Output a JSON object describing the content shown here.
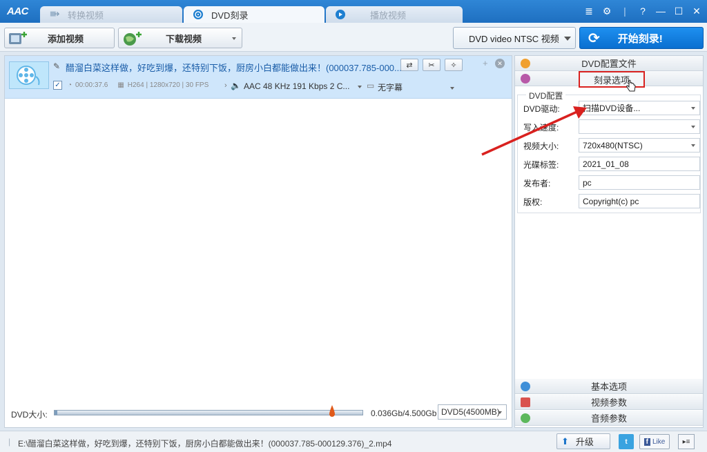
{
  "app": {
    "logo": "AAC"
  },
  "tabs": [
    {
      "label": "转换视频",
      "active": false
    },
    {
      "label": "DVD刻录",
      "active": true
    },
    {
      "label": "播放视频",
      "active": false
    }
  ],
  "window_controls": [
    "≣",
    "⚙",
    "?",
    "—",
    "☐",
    "✕"
  ],
  "toolbar": {
    "add_video": "添加视频",
    "download_video": "下载视频",
    "profile": "DVD video NTSC 视频",
    "start_burn": "开始刻录!"
  },
  "file": {
    "title": "醋溜白菜这样做，好吃到爆，还特别下饭，厨房小白都能做出来！(000037.785-000...",
    "duration": "00:00:37.6",
    "video_info": "H264 | 1280x720 | 30 FPS",
    "audio": "AAC 48 KHz 191 Kbps 2 C...",
    "subtitle": "无字幕",
    "checked": true
  },
  "size_bar": {
    "label": "DVD大小:",
    "value": "0.036Gb/4.500Gb",
    "disc_type": "DVD5(4500MB)",
    "progress": 0.008
  },
  "right_panel": {
    "profile_header": "DVD配置文件",
    "burn_options_header": "刻录选项",
    "group_title": "DVD配置",
    "fields": [
      {
        "label": "DVD驱动:",
        "value": "扫描DVD设备...",
        "dropdown": true
      },
      {
        "label": "写入速度:",
        "value": "",
        "dropdown": true
      },
      {
        "label": "视频大小:",
        "value": "720x480(NTSC)",
        "dropdown": true
      },
      {
        "label": "光碟标签:",
        "value": "2021_01_08",
        "dropdown": false
      },
      {
        "label": "发布者:",
        "value": "pc",
        "dropdown": false
      },
      {
        "label": "版权:",
        "value": "Copyright(c) pc",
        "dropdown": false
      }
    ],
    "basic_options": "基本选项",
    "video_params": "视频参数",
    "audio_params": "音频参数"
  },
  "status": {
    "path": "E:\\醋溜白菜这样做，好吃到爆，还特别下饭，厨房小白都能做出来！(000037.785-000129.376)_2.mp4",
    "upgrade": "升级",
    "like": "Like"
  },
  "colors": {
    "accent": "#1e6fc0",
    "start_button": "#0a6fd0",
    "selected_row": "#cfe6fb",
    "highlight_box": "#d9211f",
    "annotation_arrow": "#d9211f"
  }
}
